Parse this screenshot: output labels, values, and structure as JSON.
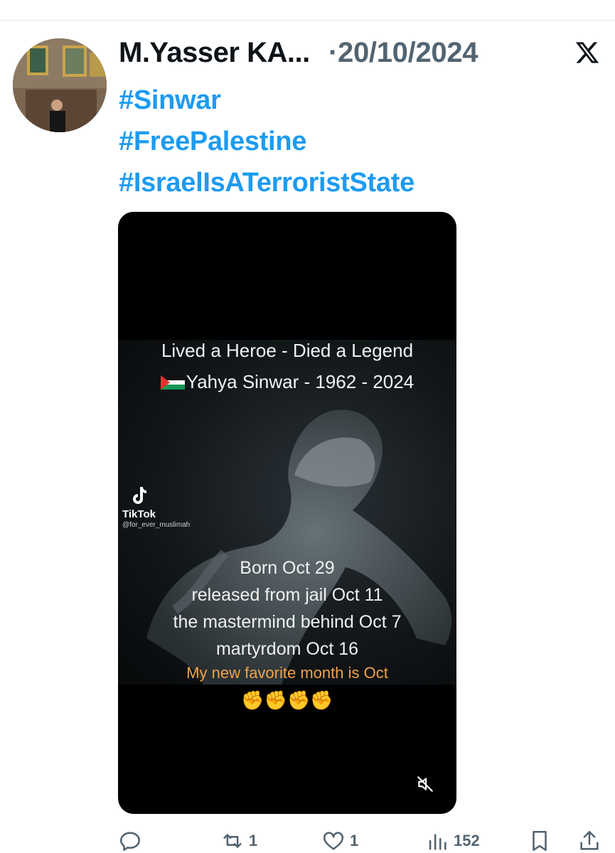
{
  "tweet": {
    "author_name": "M.Yasser KA...",
    "separator": "·",
    "date": "20/10/2024",
    "hashtags": [
      "#Sinwar",
      "#FreePalestine",
      "#IsraelIsATerroristState"
    ]
  },
  "media": {
    "title_line1": "Lived a Heroe - Died a Legend",
    "title_line2": "Yahya Sinwar - 1962 - 2024",
    "watermark_brand": "TikTok",
    "watermark_handle": "@for_ever_muslimah",
    "facts": [
      "Born Oct 29",
      "released from jail Oct 11",
      "the mastermind behind Oct 7",
      "martyrdom Oct 16"
    ],
    "favorite_line": "My new favorite month is Oct",
    "emoji_line": "✊✊✊✊"
  },
  "actions": {
    "retweets": "1",
    "likes": "1",
    "views": "152"
  },
  "colors": {
    "hashtag": "#1d9bf0",
    "secondary_text": "#536471",
    "favorite_text": "#f0a24a"
  },
  "icons": [
    "x-logo-icon",
    "mute-icon",
    "reply-icon",
    "retweet-icon",
    "like-icon",
    "views-icon",
    "bookmark-icon",
    "share-icon",
    "tiktok-icon",
    "palestine-flag-icon"
  ]
}
